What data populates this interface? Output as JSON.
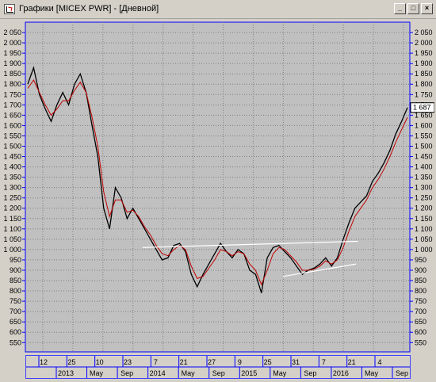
{
  "window": {
    "title": "Графики [MICEX PWR] - [Дневной]",
    "buttons": {
      "minimize": "_",
      "maximize": "□",
      "close": "×"
    }
  },
  "colors": {
    "plot_bg": "#c0c0c0",
    "grid": "#808080",
    "axis": "#0000ff",
    "price": "#000000",
    "ma": "#c00000",
    "trendline": "#ffffff",
    "last_price_box": "#ffffff"
  },
  "chart_data": {
    "type": "line",
    "xlabel": "",
    "ylabel": "",
    "ylim": [
      505,
      2100
    ],
    "yticks": [
      "550",
      "600",
      "650",
      "700",
      "750",
      "800",
      "850",
      "900",
      "950",
      "1 000",
      "1 050",
      "1 100",
      "1 150",
      "1 200",
      "1 250",
      "1 300",
      "1 350",
      "1 400",
      "1 450",
      "1 500",
      "1 550",
      "1 600",
      "1 650",
      "1 700",
      "1 750",
      "1 800",
      "1 850",
      "1 900",
      "1 950",
      "2 000",
      "2 050"
    ],
    "last_price_label": "1 687",
    "x_ticks_row1": [
      "12",
      "25",
      "10",
      "23",
      "7",
      "21",
      "27",
      "9",
      "25",
      "31",
      "7",
      "21",
      "4"
    ],
    "x_ticks_row2": [
      "2013",
      "May",
      "Sep",
      "2014",
      "May",
      "Sep",
      "2015",
      "May",
      "Sep",
      "2016",
      "May",
      "Sep"
    ],
    "series": [
      {
        "values": [
          1800,
          1880,
          1750,
          1680,
          1620,
          1700,
          1760,
          1700,
          1800,
          1850,
          1760,
          1600,
          1450,
          1200,
          1100,
          1300,
          1250,
          1150,
          1200,
          1150,
          1100,
          1050,
          1000,
          950,
          960,
          1020,
          1030,
          990,
          880,
          820,
          880,
          930,
          980,
          1030,
          990,
          960,
          1000,
          980,
          900,
          880,
          790,
          960,
          1010,
          1020,
          990,
          960,
          920,
          880,
          900,
          910,
          930,
          960,
          920,
          960,
          1050,
          1130,
          1200,
          1230,
          1260,
          1330,
          1370,
          1420,
          1480,
          1560,
          1620,
          1687
        ]
      },
      {
        "values": [
          1780,
          1820,
          1760,
          1700,
          1650,
          1680,
          1720,
          1720,
          1770,
          1810,
          1760,
          1640,
          1500,
          1280,
          1160,
          1240,
          1240,
          1180,
          1190,
          1160,
          1110,
          1070,
          1020,
          980,
          970,
          1000,
          1020,
          1000,
          920,
          860,
          870,
          910,
          950,
          1000,
          990,
          970,
          990,
          980,
          930,
          900,
          830,
          900,
          980,
          1010,
          1000,
          970,
          940,
          900,
          900,
          905,
          920,
          945,
          930,
          950,
          1010,
          1090,
          1160,
          1200,
          1240,
          1300,
          1340,
          1390,
          1450,
          1520,
          1580,
          1640
        ]
      }
    ],
    "trendlines": [
      {
        "from": [
          0.305,
          1010
        ],
        "to": [
          0.865,
          1040
        ]
      },
      {
        "from": [
          0.67,
          870
        ],
        "to": [
          0.86,
          930
        ]
      }
    ]
  }
}
